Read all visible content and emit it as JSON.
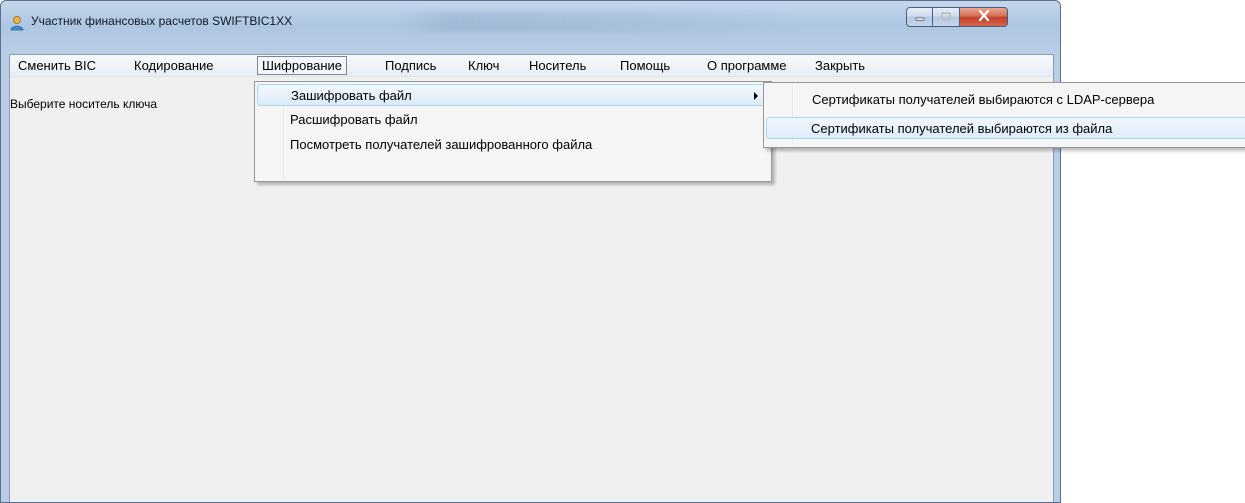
{
  "window": {
    "title": "Участник финансовых расчетов SWIFTBIC1XX"
  },
  "icons": {
    "app": "user-icon",
    "minimize": "minimize-icon",
    "maximize": "maximize-icon",
    "close": "close-icon",
    "submenu": "chevron-right-icon"
  },
  "menubar": {
    "items": [
      {
        "label": "Сменить BIC"
      },
      {
        "label": "Кодирование"
      },
      {
        "label": "Шифрование"
      },
      {
        "label": "Подпись"
      },
      {
        "label": "Ключ"
      },
      {
        "label": "Носитель"
      },
      {
        "label": "Помощь"
      },
      {
        "label": "О программе"
      },
      {
        "label": "Закрыть"
      }
    ]
  },
  "status": {
    "text": "Выберите носитель ключа"
  },
  "encrypt_menu": {
    "items": [
      {
        "label": "Зашифровать файл"
      },
      {
        "label": "Расшифровать файл"
      },
      {
        "label": "Посмотреть получателей зашифрованного файла"
      }
    ]
  },
  "encrypt_submenu": {
    "items": [
      {
        "label": "Сертификаты получателей выбираются с LDAP-сервера"
      },
      {
        "label": "Сертификаты получателей выбираются из файла"
      }
    ]
  },
  "colors": {
    "menu_hover": "#dcecf8",
    "close_button": "#c2402a"
  }
}
